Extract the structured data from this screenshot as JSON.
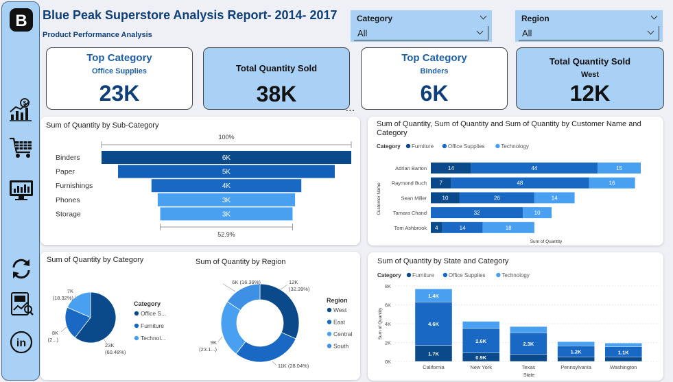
{
  "header": {
    "title": "Blue Peak Superstore Analysis Report- 2014- 2017",
    "subtitle": "Product Performance Analysis"
  },
  "slicers": {
    "category": {
      "label": "Category",
      "value": "All"
    },
    "region": {
      "label": "Region",
      "value": "All"
    }
  },
  "kpis": [
    {
      "title": "Top Category",
      "subtitle": "Office Supplies",
      "value": "23K"
    },
    {
      "title": "Total Quantity Sold",
      "subtitle": "",
      "value": "38K"
    },
    {
      "title": "Top Category",
      "subtitle": "Binders",
      "value": "6K"
    },
    {
      "title": "Total Quantity Sold",
      "subtitle": "West",
      "value": "12K"
    }
  ],
  "more_options": "...",
  "colors": {
    "dark": "#0a4a8a",
    "mid": "#1868c4",
    "light": "#4aa0f0",
    "sidebar": "#a9d0f5",
    "title": "#0f3f78"
  },
  "icons": [
    "logo-b-icon",
    "finance-chart-icon",
    "shopping-cart-icon",
    "monitor-dashboard-icon",
    "refresh-icon",
    "report-icon",
    "linkedin-icon"
  ],
  "chart_data": [
    {
      "type": "bar",
      "subtype": "funnel",
      "title": "Sum of Quantity by Sub-Category",
      "categories": [
        "Binders",
        "Paper",
        "Furnishings",
        "Phones",
        "Storage"
      ],
      "values": [
        6000,
        5000,
        4000,
        3000,
        3000
      ],
      "data_labels": [
        "6K",
        "5K",
        "4K",
        "3K",
        "3K"
      ],
      "top_label": "100%",
      "bottom_label": "52.9%"
    },
    {
      "type": "bar",
      "subtype": "stacked-horizontal",
      "title": "Sum of Quantity, Sum of Quantity and Sum of Quantity by Customer Name and Category",
      "legend_title": "Category",
      "legend_position": "top-left",
      "categories": [
        "Adrian Barton",
        "Raymond Buch",
        "Sean Miller",
        "Tamara Chand",
        "Tom Ashbrook"
      ],
      "series": [
        {
          "name": "Furniture",
          "values": [
            14,
            7,
            10,
            null,
            4
          ]
        },
        {
          "name": "Office Supplies",
          "values": [
            44,
            48,
            26,
            32,
            14
          ]
        },
        {
          "name": "Technology",
          "values": [
            15,
            16,
            14,
            10,
            18
          ]
        }
      ],
      "xlabel": "Sum of Quantity",
      "ylabel": "Customer Name"
    },
    {
      "type": "pie",
      "title": "Sum of Quantity by Category",
      "legend_title": "Category",
      "legend_position": "right",
      "legend_labels": [
        "Office S...",
        "Furniture",
        "Technol..."
      ],
      "categories": [
        "Office Supplies",
        "Furniture",
        "Technology"
      ],
      "values": [
        23000,
        8000,
        7000
      ],
      "percents": [
        60.48,
        21.2,
        18.32
      ],
      "data_labels": [
        {
          "value": "23K",
          "pct": "(60.48%)"
        },
        {
          "value": "8K",
          "pct": "(2...)"
        },
        {
          "value": "7K",
          "pct": "(18.32%)"
        }
      ]
    },
    {
      "type": "pie",
      "subtype": "donut",
      "title": "Sum of Quantity by Region",
      "legend_title": "Region",
      "legend_position": "right",
      "categories": [
        "West",
        "East",
        "Central",
        "South"
      ],
      "values": [
        12000,
        11000,
        9000,
        6000
      ],
      "percents": [
        32.39,
        28.04,
        23.1,
        16.39
      ],
      "data_labels": [
        {
          "value": "12K",
          "pct": "(32.39%)"
        },
        {
          "value": "11K",
          "pct": "(28.04%)"
        },
        {
          "value": "9K",
          "pct": "(23.1...)"
        },
        {
          "value": "6K",
          "pct": "(16.39%)"
        }
      ]
    },
    {
      "type": "bar",
      "subtype": "stacked-column",
      "title": "Sum of Quantity by State and Category",
      "legend_title": "Category",
      "legend_position": "top-left",
      "categories": [
        "California",
        "New York",
        "Texas",
        "Pennsylvania",
        "Washington"
      ],
      "series": [
        {
          "name": "Furniture",
          "values": [
            1.7,
            0.9,
            0.75,
            0.45,
            0.45
          ]
        },
        {
          "name": "Office Supplies",
          "values": [
            4.6,
            2.6,
            2.3,
            1.2,
            1.1
          ]
        },
        {
          "name": "Technology",
          "values": [
            1.4,
            0.75,
            0.65,
            0.45,
            0.4
          ]
        }
      ],
      "data_labels": {
        "Furniture": [
          "1.7K",
          "0.9K",
          "",
          "",
          ""
        ],
        "Office Supplies": [
          "4.6K",
          "2.6K",
          "2.3K",
          "1.2K",
          "1.1K"
        ],
        "Technology": [
          "1.4K",
          "",
          "",
          "",
          ""
        ]
      },
      "y_ticks": [
        "0K",
        "2K",
        "4K",
        "6K",
        "8K"
      ],
      "ylim": [
        0,
        8
      ],
      "xlabel": "State",
      "ylabel": "Sum of Quantity"
    }
  ]
}
